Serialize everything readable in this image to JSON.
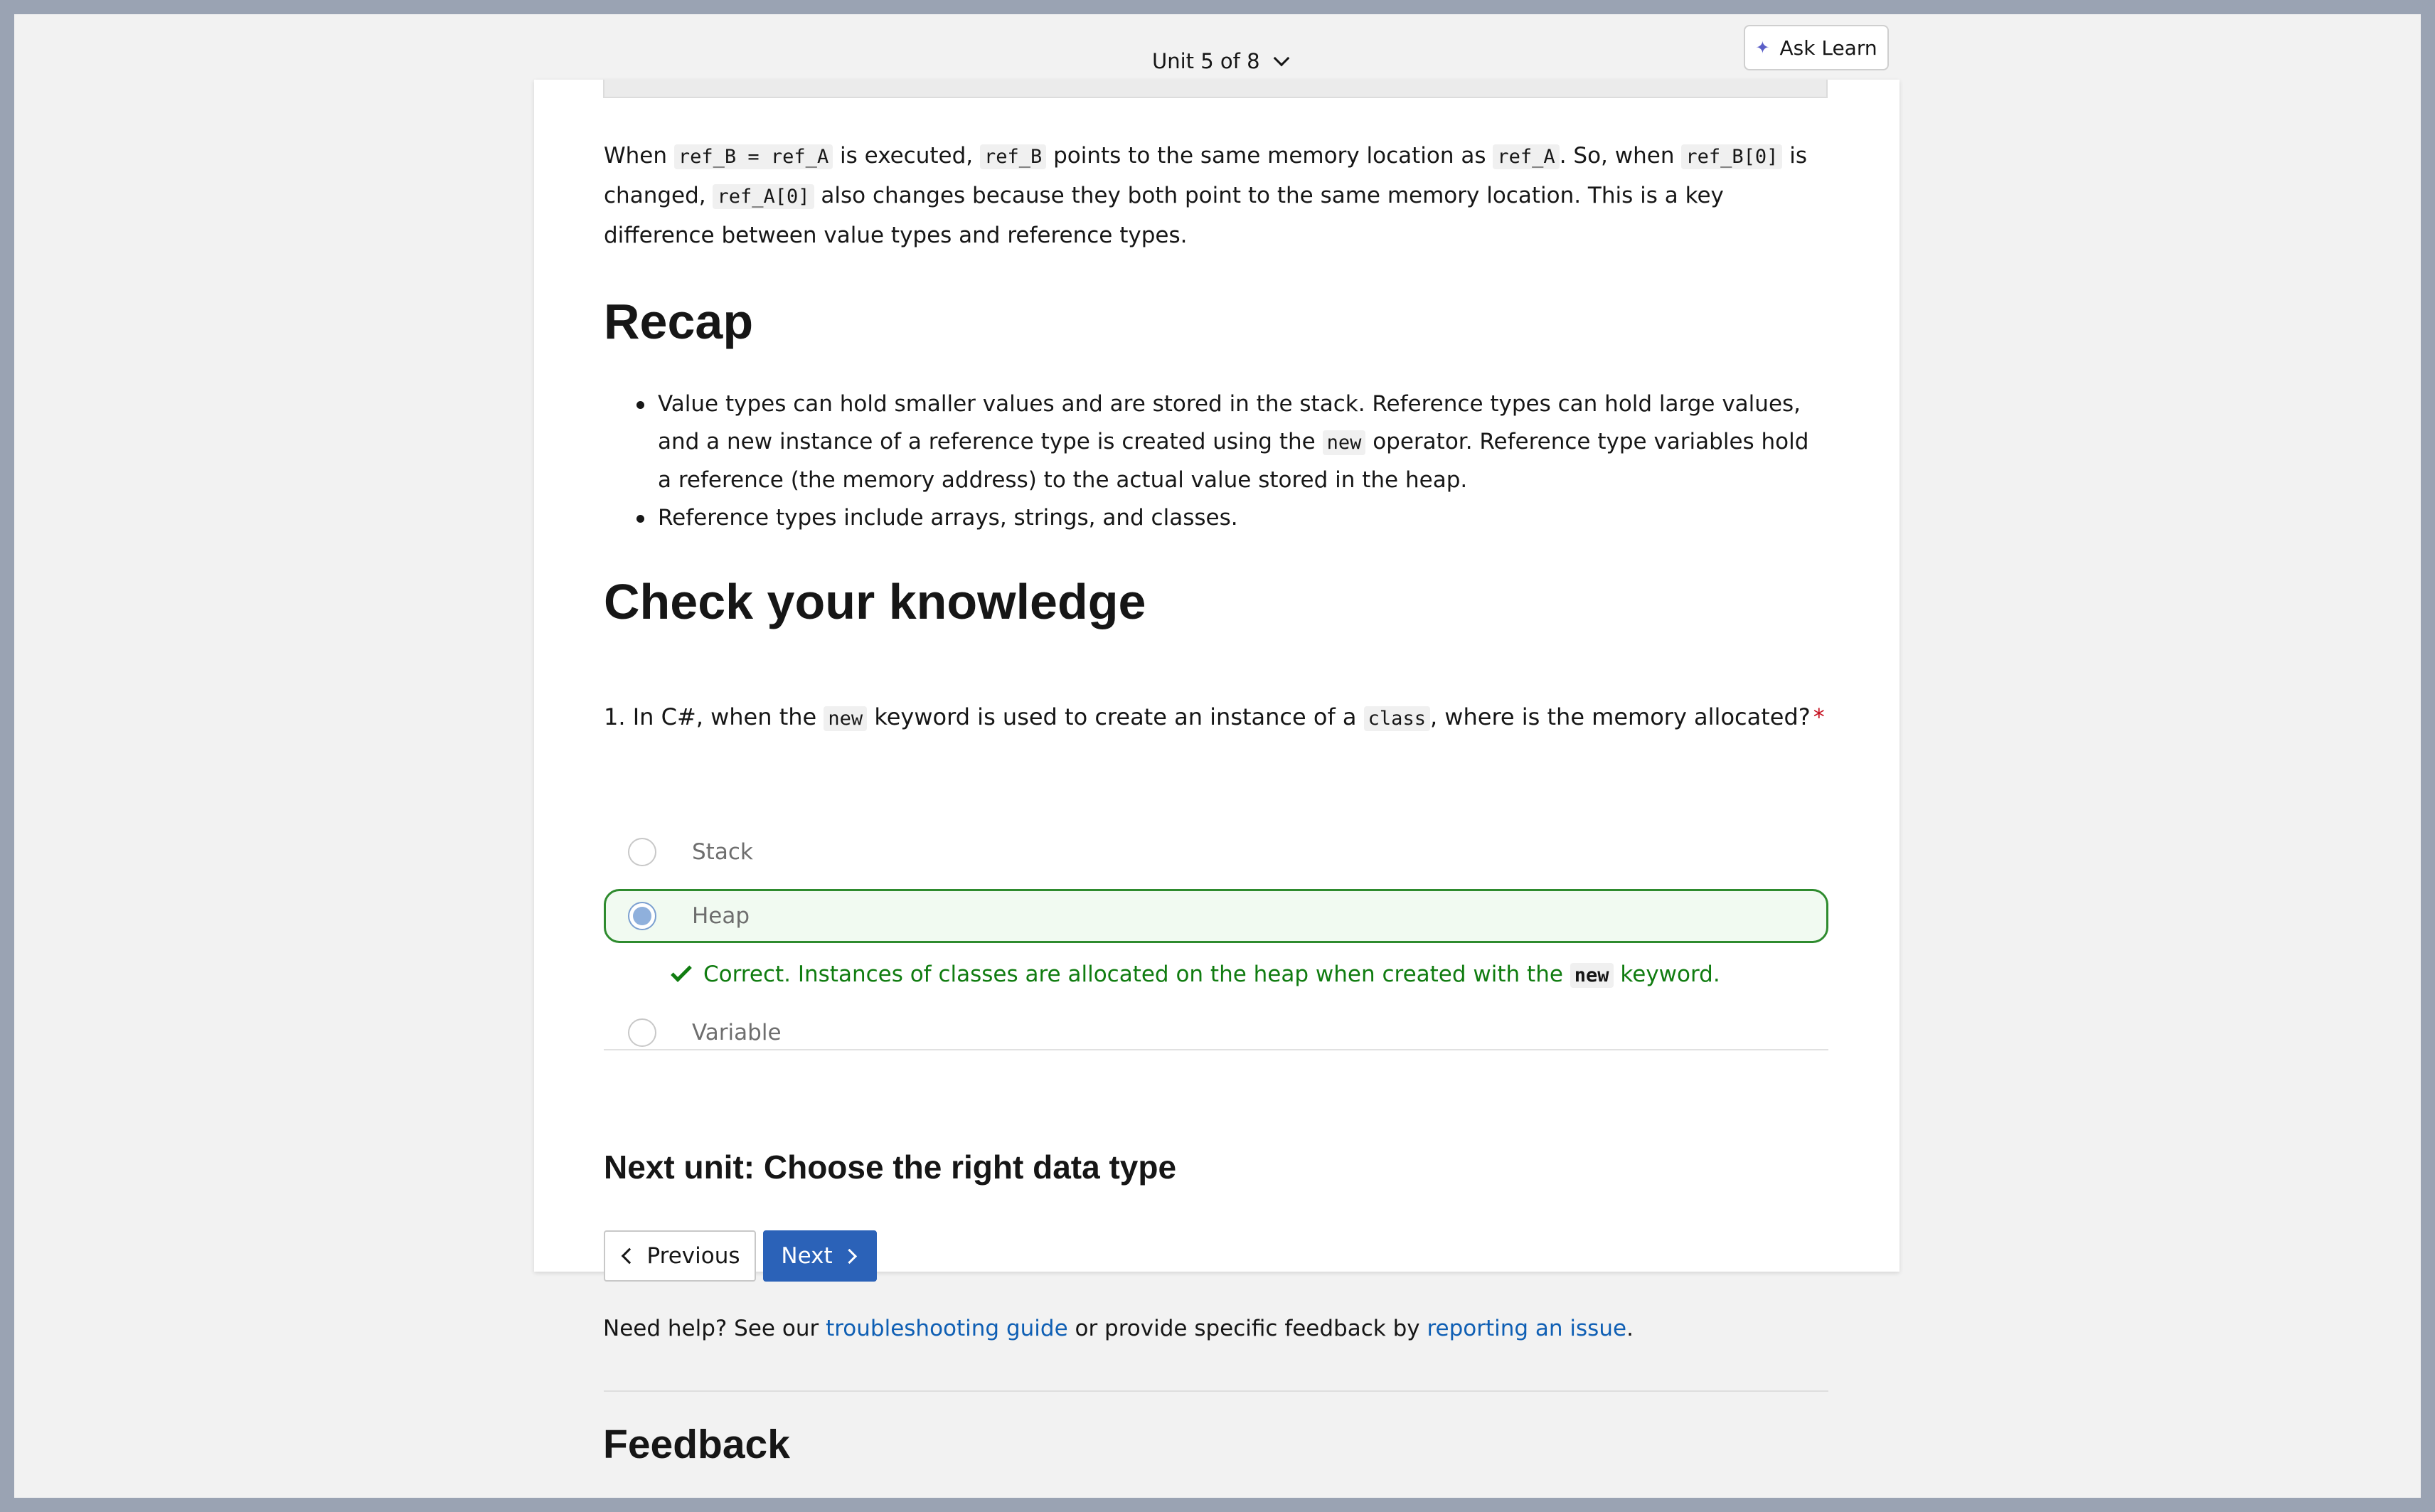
{
  "header": {
    "unit_nav": "Unit 5 of 8",
    "ask_learn": "Ask Learn"
  },
  "intro_paragraph": {
    "p1": "When ",
    "c1": "ref_B = ref_A",
    "p2": " is executed, ",
    "c2": "ref_B",
    "p3": " points to the same memory location as ",
    "c3": "ref_A",
    "p4": ". So, when ",
    "c4": "ref_B[0]",
    "p5": " is changed, ",
    "c5": "ref_A[0]",
    "p6": " also changes because they both point to the same memory location. This is a key difference between value types and reference types."
  },
  "recap": {
    "heading": "Recap",
    "bullet1": {
      "p1": "Value types can hold smaller values and are stored in the stack. Reference types can hold large values, and a new instance of a reference type is created using the ",
      "code": "new",
      "p2": " operator. Reference type variables hold a reference (the memory address) to the actual value stored in the heap."
    },
    "bullet2": "Reference types include arrays, strings, and classes."
  },
  "knowledge": {
    "heading": "Check your knowledge",
    "question": {
      "p1": "1. In C#, when the ",
      "c1": "new",
      "p2": " keyword is used to create an instance of a ",
      "c2": "class",
      "p3": ", where is the memory allocated?",
      "required_marker": "*"
    },
    "options": [
      {
        "label": "Stack",
        "selected": false
      },
      {
        "label": "Heap",
        "selected": true
      },
      {
        "label": "Variable",
        "selected": false
      }
    ],
    "feedback": {
      "p1": "Correct. Instances of classes are allocated on the heap when created with the ",
      "code": "new",
      "p2": " keyword."
    },
    "correct_color": "#107c10"
  },
  "next_unit": {
    "title": "Next unit: Choose the right data type",
    "previous_label": "Previous",
    "next_label": "Next",
    "accent": "#2b62b8"
  },
  "help": {
    "p1": "Need help? See our ",
    "link1": "troubleshooting guide",
    "p2": " or provide specific feedback by ",
    "link2": "reporting an issue",
    "p3": "."
  },
  "feedback_section": {
    "heading": "Feedback"
  }
}
